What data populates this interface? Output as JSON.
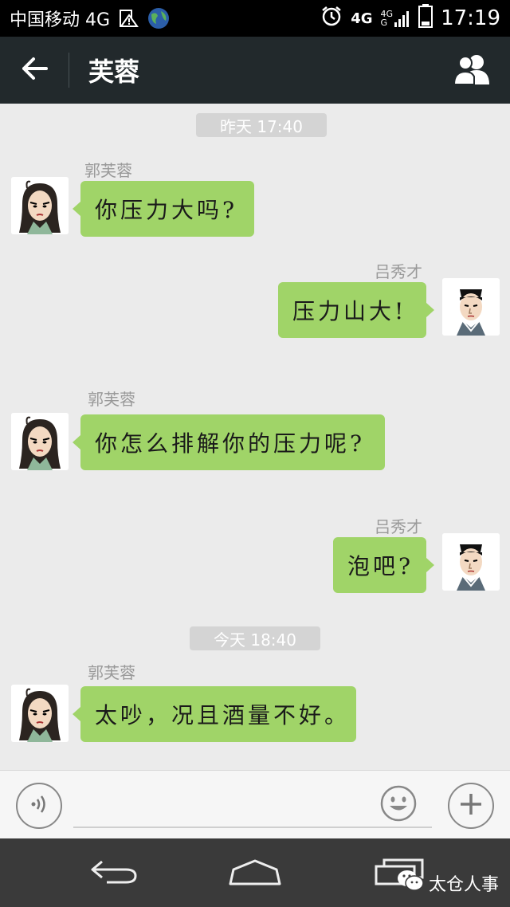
{
  "status_bar": {
    "carrier": "中国移动 4G",
    "net_left": "4G",
    "net_top": "4G",
    "net_bottom": "G",
    "time": "17:19"
  },
  "title_bar": {
    "title": "芙蓉",
    "back_icon": "arrow-left-icon",
    "contacts_icon": "people-icon"
  },
  "messages": [
    {
      "type": "timestamp",
      "text": "昨天 17:40"
    },
    {
      "type": "msg",
      "side": "left",
      "sender": "郭芙蓉",
      "text": "你压力大吗?"
    },
    {
      "type": "msg",
      "side": "right",
      "sender": "吕秀才",
      "text": "压力山大!"
    },
    {
      "type": "msg",
      "side": "left",
      "sender": "郭芙蓉",
      "text": "你怎么排解你的压力呢?"
    },
    {
      "type": "msg",
      "side": "right",
      "sender": "吕秀才",
      "text": "泡吧?"
    },
    {
      "type": "timestamp",
      "text": "今天 18:40"
    },
    {
      "type": "msg",
      "side": "left",
      "sender": "郭芙蓉",
      "text": "太吵，况且酒量不好。"
    }
  ],
  "input_bar": {
    "value": "",
    "placeholder": ""
  },
  "watermark": "太仓人事",
  "colors": {
    "bubble": "#a0d468",
    "title_bar": "#22292c",
    "chat_bg": "#ebebeb"
  }
}
